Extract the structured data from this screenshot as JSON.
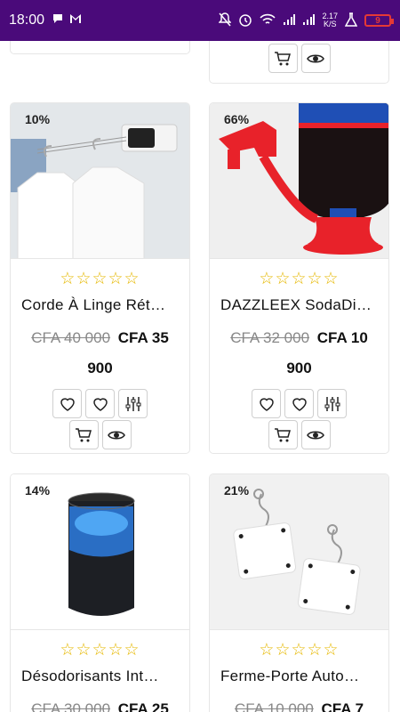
{
  "status_bar": {
    "time": "18:00",
    "network_speed_value": "2.17",
    "network_speed_unit": "K/S",
    "battery_level": "9"
  },
  "products": [
    {
      "discount": "10%",
      "rating_stars": "☆☆☆☆☆",
      "title": "Corde À Linge Rét…",
      "old_price": "CFA 40 000",
      "new_price_part1": "CFA 35",
      "new_price_part2": "900",
      "image_icon": "clothesline-image"
    },
    {
      "discount": "66%",
      "rating_stars": "☆☆☆☆☆",
      "title": "DAZZLEEX SodaDi…",
      "old_price": "CFA 32 000",
      "new_price_part1": "CFA 10",
      "new_price_part2": "900",
      "image_icon": "soda-dispenser-image"
    },
    {
      "discount": "14%",
      "rating_stars": "☆☆☆☆☆",
      "title": "Désodorisants Int…",
      "old_price": "CFA 30 000",
      "new_price_part1": "CFA 25",
      "new_price_part2": "",
      "image_icon": "air-purifier-image"
    },
    {
      "discount": "21%",
      "rating_stars": "☆☆☆☆☆",
      "title": "Ferme-Porte Auto…",
      "old_price": "CFA 10 000",
      "new_price_part1": "CFA 7",
      "new_price_part2": "",
      "image_icon": "door-closer-image"
    }
  ],
  "colors": {
    "status_bar": "#4a0a7a",
    "star": "#e6b800",
    "soda_red": "#e8222a"
  }
}
